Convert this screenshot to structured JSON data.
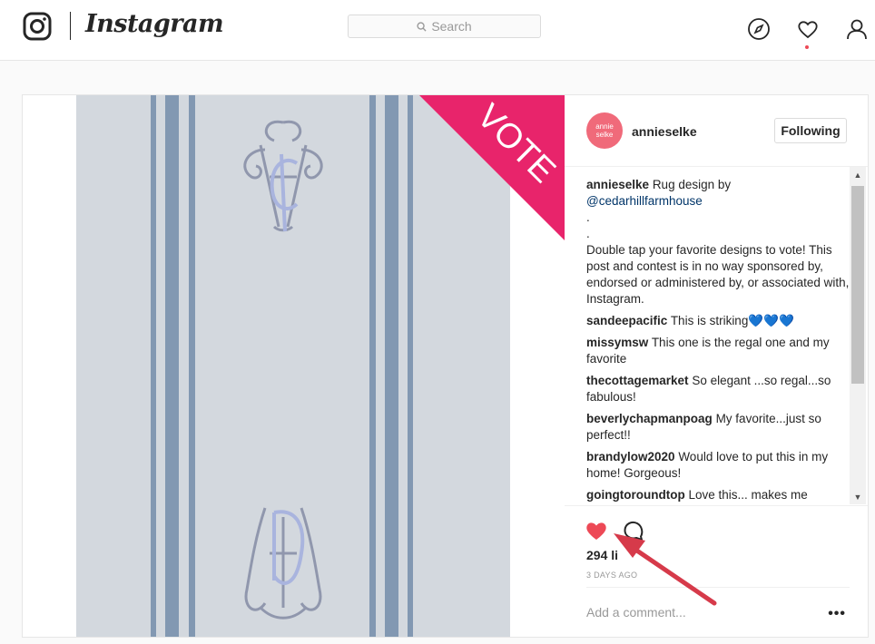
{
  "app": {
    "wordmark": "Instagram"
  },
  "search": {
    "placeholder": "Search"
  },
  "post": {
    "vote_label": "VOTE",
    "author": {
      "username": "annieselke",
      "avatar_text": "annie selke"
    },
    "follow_label": "Following",
    "comments": [
      {
        "user": "annieselke",
        "text_before": "Rug design by ",
        "mention": "@cedarhillfarmhouse"
      },
      {
        "user": "",
        "text": "."
      },
      {
        "user": "",
        "text": "."
      },
      {
        "user": "",
        "text": "Double tap your favorite designs to vote! This post and contest is in no way sponsored by, endorsed or administered by, or associated with, Instagram."
      },
      {
        "user": "sandeepacific",
        "text": "This is striking",
        "emoji": "💙💙💙"
      },
      {
        "user": "missymsw",
        "text": "This one is the regal one and my favorite"
      },
      {
        "user": "thecottagemarket",
        "text": "So elegant ...so regal...so fabulous!"
      },
      {
        "user": "beverlychapmanpoag",
        "text": "My favorite...just so perfect!!"
      },
      {
        "user": "brandylow2020",
        "text": "Would love to put this in my home! Gorgeous!"
      },
      {
        "user": "goingtoroundtop",
        "text": "Love this... makes me"
      }
    ],
    "likes_label": "294 li",
    "time_ago": "3 DAYS AGO",
    "add_comment_placeholder": "Add a comment...",
    "more_label": "•••"
  },
  "colors": {
    "like_red": "#ed4956",
    "vote_pink": "#e8246b",
    "arrow_red": "#d63a4a",
    "stripe_blue": "#8298b2"
  },
  "icons": {
    "logo": "instagram-camera-icon",
    "explore": "compass-icon",
    "activity": "heart-outline-icon",
    "profile": "person-icon",
    "like": "heart-filled-icon",
    "comment": "comment-bubble-icon"
  }
}
